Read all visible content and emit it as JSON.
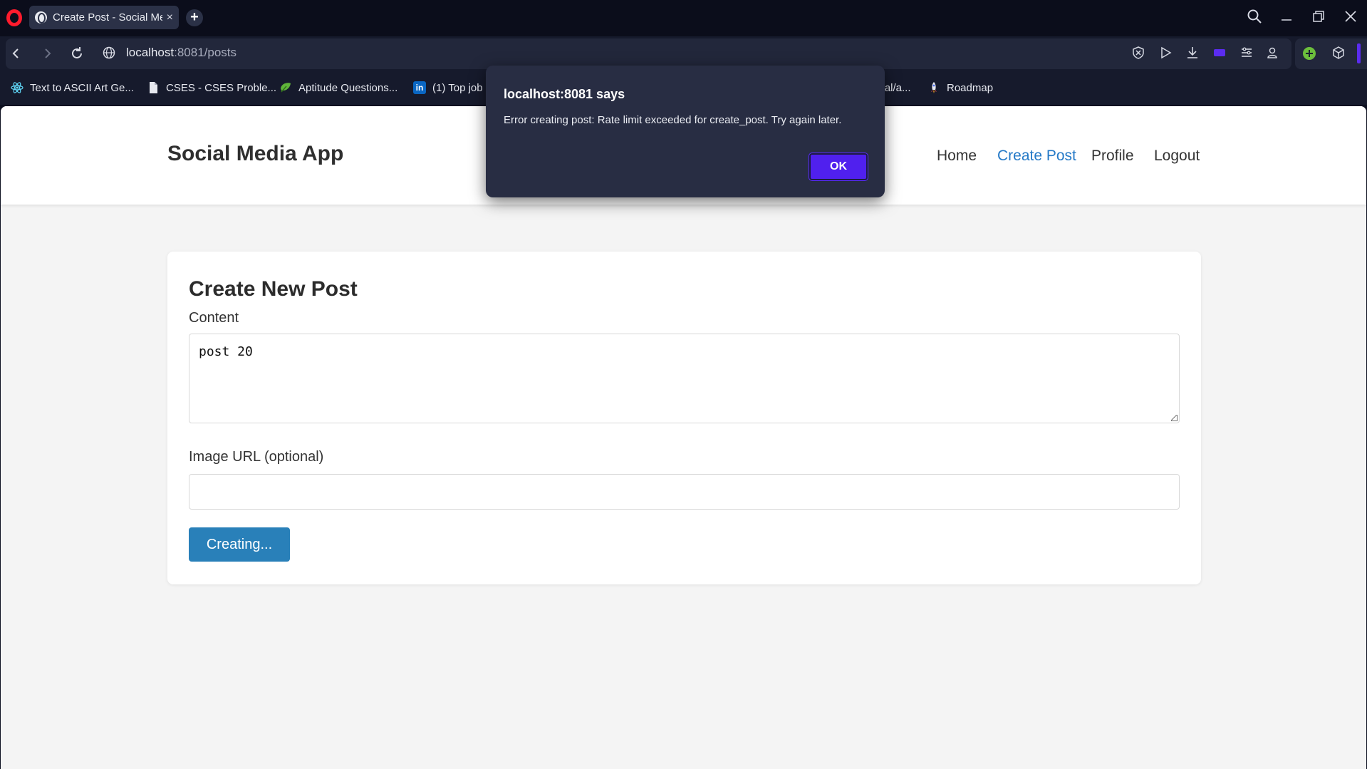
{
  "browser": {
    "tab_title": "Create Post - Social Media App",
    "tab_close": "×",
    "new_tab": "+",
    "url_host": "localhost",
    "url_rest": ":8081/posts",
    "bookmarks": [
      {
        "label": "Text to ASCII Art Ge...",
        "icon": "react-icon"
      },
      {
        "label": "CSES - CSES Proble...",
        "icon": "document-icon"
      },
      {
        "label": "Aptitude Questions...",
        "icon": "leaf-icon"
      },
      {
        "label": "(1) Top job",
        "icon": "linkedin-icon"
      },
      {
        "label": "wal/a...",
        "icon": ""
      },
      {
        "label": "Roadmap",
        "icon": "rocket-icon"
      }
    ],
    "accent_color": "#5020ee"
  },
  "app": {
    "brand": "Social Media App",
    "nav": {
      "home": "Home",
      "create_post": "Create Post",
      "profile": "Profile",
      "logout": "Logout"
    },
    "active_nav_color": "#2479c7"
  },
  "form": {
    "title": "Create New Post",
    "content_label": "Content",
    "content_value": "post 20",
    "image_label": "Image URL (optional)",
    "image_value": "",
    "submit_label": "Creating...",
    "button_color": "#2980b9"
  },
  "dialog": {
    "title": "localhost:8081 says",
    "message": "Error creating post: Rate limit exceeded for create_post. Try again later.",
    "ok_label": "OK"
  }
}
